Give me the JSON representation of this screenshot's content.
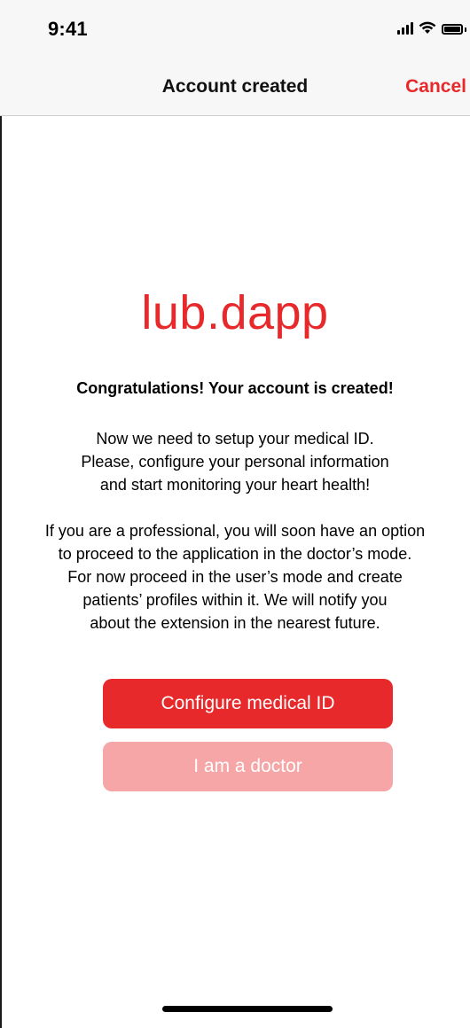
{
  "status_bar": {
    "time": "9:41",
    "icons": [
      "signal-icon",
      "wifi-icon",
      "battery-icon"
    ]
  },
  "nav": {
    "title": "Account created",
    "cancel_label": "Cancel"
  },
  "logo": {
    "text": "lub.dapp"
  },
  "content": {
    "headline": "Congratulations! Your account is created!",
    "para1": [
      "Now we need to setup your medical ID.",
      "Please, configure your personal information",
      "and start monitoring your heart health!"
    ],
    "para2": [
      "If you are a professional, you will soon have an option",
      "to proceed to the application in the doctor’s mode.",
      "For now proceed in the user’s mode and create",
      "patients’ profiles within it. We will notify you",
      "about the extension in the nearest future."
    ]
  },
  "buttons": {
    "primary_label": "Configure medical ID",
    "secondary_label": "I am a doctor"
  },
  "colors": {
    "accent": "#e8292b",
    "accent_disabled": "#f6a6a7",
    "bar_bg": "#f7f7f7"
  }
}
